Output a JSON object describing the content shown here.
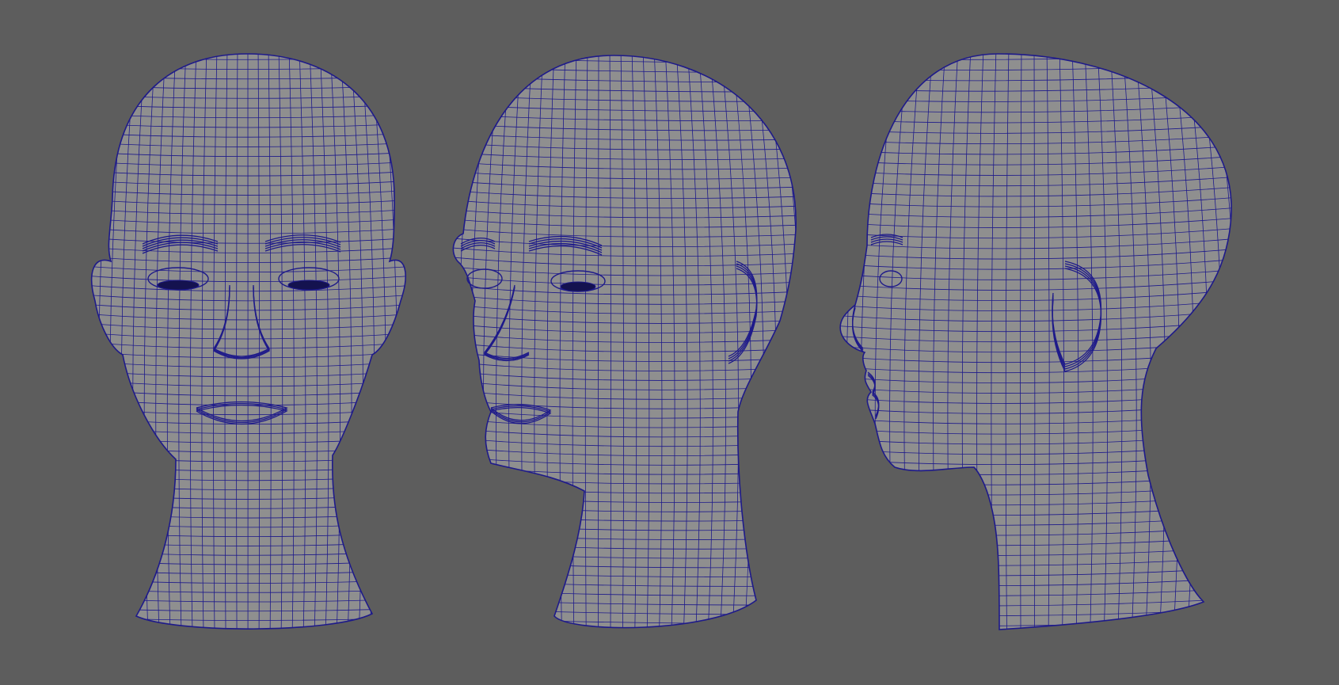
{
  "viewport": {
    "background": "#5d5d5d",
    "mesh_fill": "#8f8f8f",
    "wire_color": "#1e1a8a",
    "shading": "wireframe-on-shaded",
    "views": [
      {
        "name": "front",
        "model": "female-head-base-mesh"
      },
      {
        "name": "three-quarter",
        "model": "female-head-base-mesh"
      },
      {
        "name": "profile",
        "model": "female-head-base-mesh"
      }
    ]
  }
}
